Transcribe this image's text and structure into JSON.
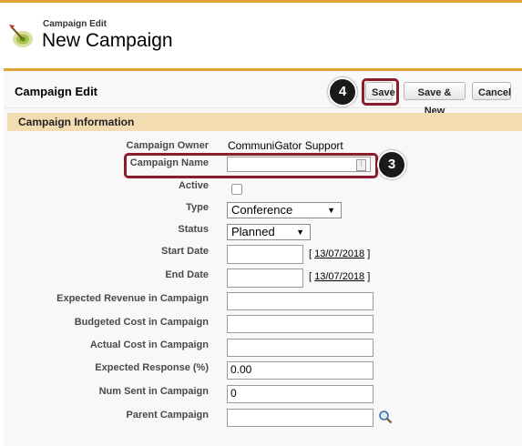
{
  "header": {
    "subtitle": "Campaign Edit",
    "title": "New Campaign",
    "icon": "campaign-target-icon"
  },
  "panel": {
    "title": "Campaign Edit",
    "buttons": {
      "save": "Save",
      "save_new": "Save & New",
      "cancel": "Cancel"
    }
  },
  "section": {
    "title": "Campaign Information"
  },
  "annotations": {
    "step_save": "4",
    "step_name": "3",
    "highlight_color": "#8c1c2c"
  },
  "fields": {
    "owner": {
      "label": "Campaign Owner",
      "value": "CommuniGator Support"
    },
    "name": {
      "label": "Campaign Name",
      "value": ""
    },
    "active": {
      "label": "Active",
      "checked": false
    },
    "type": {
      "label": "Type",
      "value": "Conference"
    },
    "status": {
      "label": "Status",
      "value": "Planned"
    },
    "start_date": {
      "label": "Start Date",
      "value": "",
      "today": "13/07/2018"
    },
    "end_date": {
      "label": "End Date",
      "value": "",
      "today": "13/07/2018"
    },
    "expected_revenue": {
      "label": "Expected Revenue in Campaign",
      "value": ""
    },
    "budgeted_cost": {
      "label": "Budgeted Cost in Campaign",
      "value": ""
    },
    "actual_cost": {
      "label": "Actual Cost in Campaign",
      "value": ""
    },
    "expected_response": {
      "label": "Expected Response (%)",
      "value": "0.00"
    },
    "num_sent": {
      "label": "Num Sent in Campaign",
      "value": "0"
    },
    "parent": {
      "label": "Parent Campaign",
      "value": "",
      "lookup_icon": "lookup-magnifier-icon"
    }
  },
  "colors": {
    "accent": "#e0a43a",
    "section_bg": "#f3dcb2",
    "panel_bg": "#f8f8f8"
  }
}
